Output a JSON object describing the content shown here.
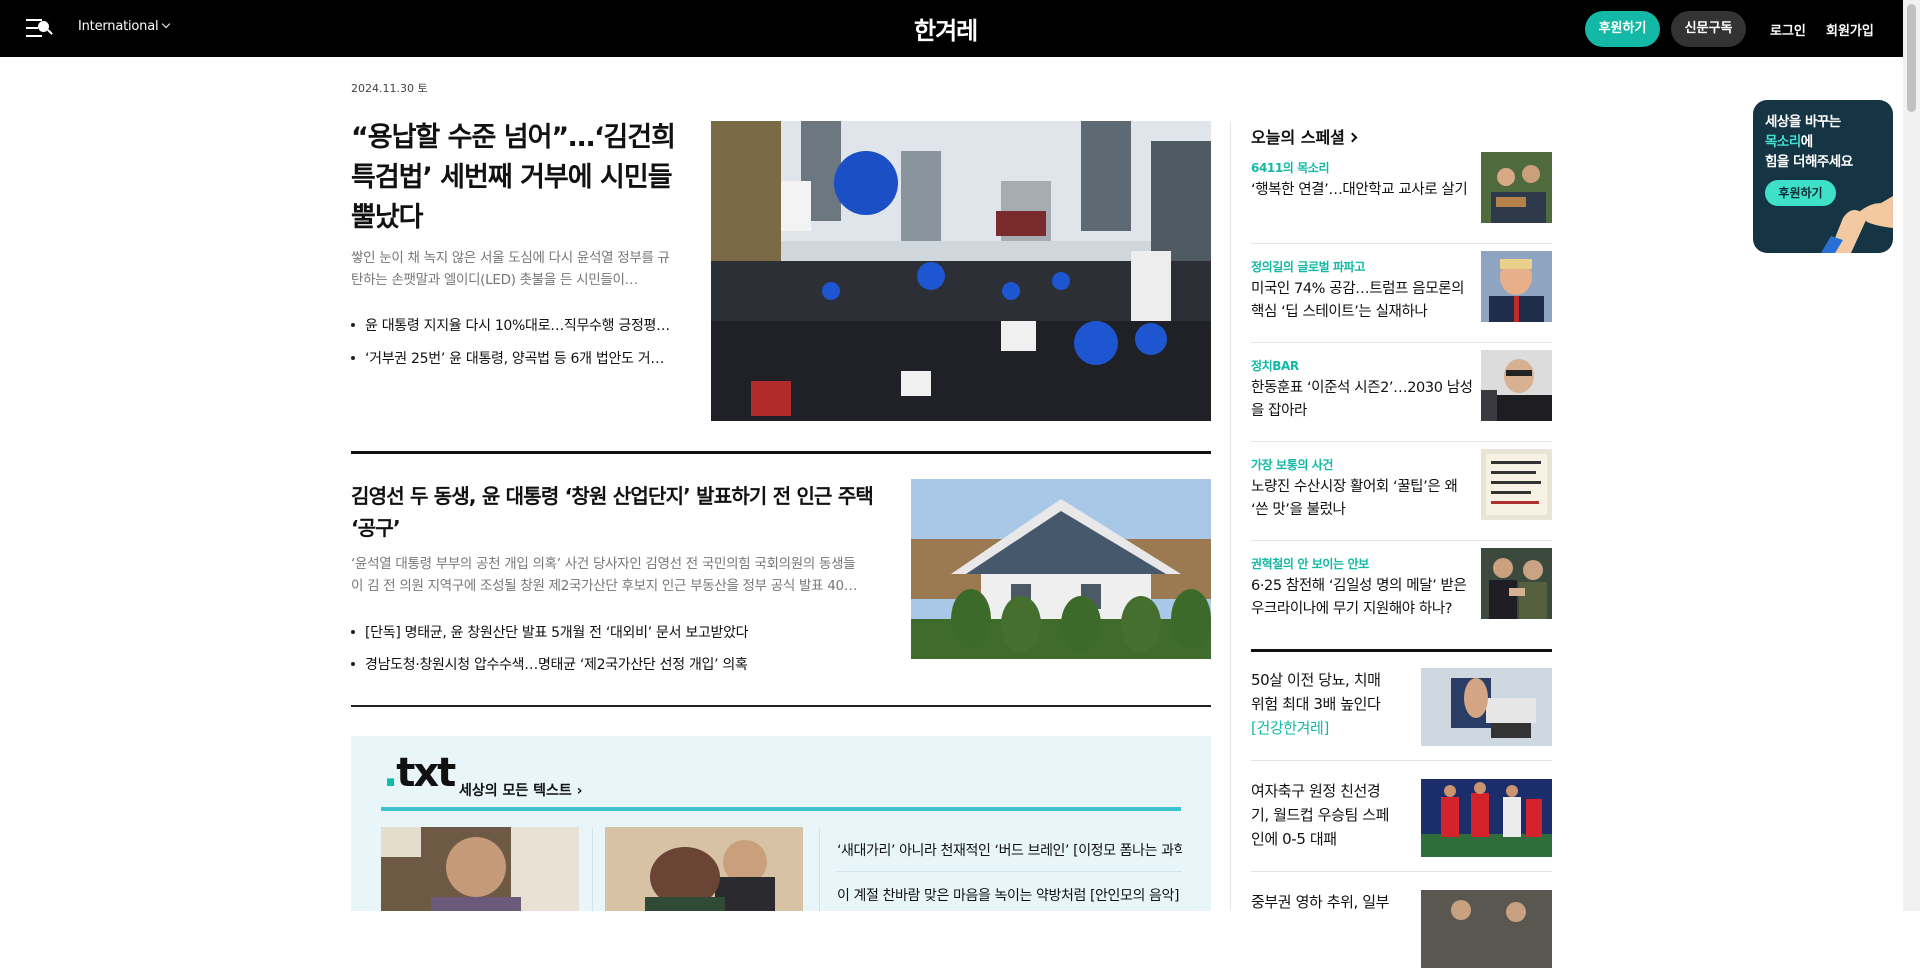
{
  "header": {
    "edition": "International",
    "logo": "한겨레",
    "donate_label": "후원하기",
    "subscribe_label": "신문구독",
    "login_label": "로그인",
    "signup_label": "회원가입"
  },
  "date": "2024.11.30 토",
  "lead": {
    "title": "“용납할 수준 넘어”…‘김건희 특검법’ 세번째 거부에 시민들 뿔났다",
    "summary": "쌓인 눈이 채 녹지 않은 서울 도심에 다시 윤석열 정부를 규탄하는 손팻말과 엘이디(LED) 촛불을 든 시민들이…",
    "related": [
      "윤 대통령 지지율 다시 10%대로…직무수행 긍정평…",
      "‘거부권 25번’ 윤 대통령, 양곡법 등 6개 법안도 거…"
    ]
  },
  "second": {
    "title": "김영선 두 동생, 윤 대통령 ‘창원 산업단지’ 발표하기 전 인근 주택 ‘공구’",
    "summary": "‘윤석열 대통령 부부의 공천 개입 의혹’ 사건 당사자인 김영선 전 국민의힘 국회의원의 동생들이 김 전 의원 지역구에 조성될 창원 제2국가산단 후보지 인근 부동산을 정부 공식 발표 40…",
    "related": [
      "[단독] 명태균, 윤 창원산단 발표 5개월 전 ‘대외비’ 문서 보고받았다",
      "경남도청·창원시청 압수수색…명태균 ‘제2국가산단 선정 개입’ 의혹"
    ]
  },
  "txt_section": {
    "logo_text": "txt",
    "subtitle": "세상의 모든 텍스트",
    "links": [
      "‘새대가리’ 아니라 천재적인 ‘버드 브레인’ [이정모 폼나는 과학]",
      "이 계절 찬바람 맞은 마음을 녹이는 약방처럼 [안인모의 음악]"
    ]
  },
  "special": {
    "heading": "오늘의 스페셜",
    "items": [
      {
        "category": "6411의 목소리",
        "title": "‘행복한 연결’…대안학교 교사로 살기"
      },
      {
        "category": "정의길의 글로벌 파파고",
        "title": "미국인 74% 공감…트럼프 음모론의 핵심 ‘딥 스테이트’는 실재하나"
      },
      {
        "category": "정치BAR",
        "title": "한동훈표 ‘이준석 시즌2’…2030 남성을 잡아라"
      },
      {
        "category": "가장 보통의 사건",
        "title": "노량진 수산시장 활어회 ‘꿀팁’은 왜 ‘쓴 맛’을 불렀나"
      },
      {
        "category": "권혁철의 안 보이는 안보",
        "title": "6·25 참전해 ‘김일성 명의 메달’ 받은 우크라이나에 무기 지원해야 하나?"
      }
    ]
  },
  "headlines": [
    {
      "title": "50살 이전 당뇨, 치매위험 최대 3배 높인다 ",
      "accent": "[건강한겨레]"
    },
    {
      "title": "여자축구 원정 친선경기, 월드컵 우승팀 스페인에 0-5 대패",
      "accent": ""
    },
    {
      "title": "중부권 영하 추위, 일부",
      "accent": ""
    }
  ],
  "promo": {
    "line1": "세상을 바꾸는",
    "line2_highlight": "목소리",
    "line2_rest": "에",
    "line3": "힘을 더해주세요",
    "button_label": "후원하기"
  }
}
